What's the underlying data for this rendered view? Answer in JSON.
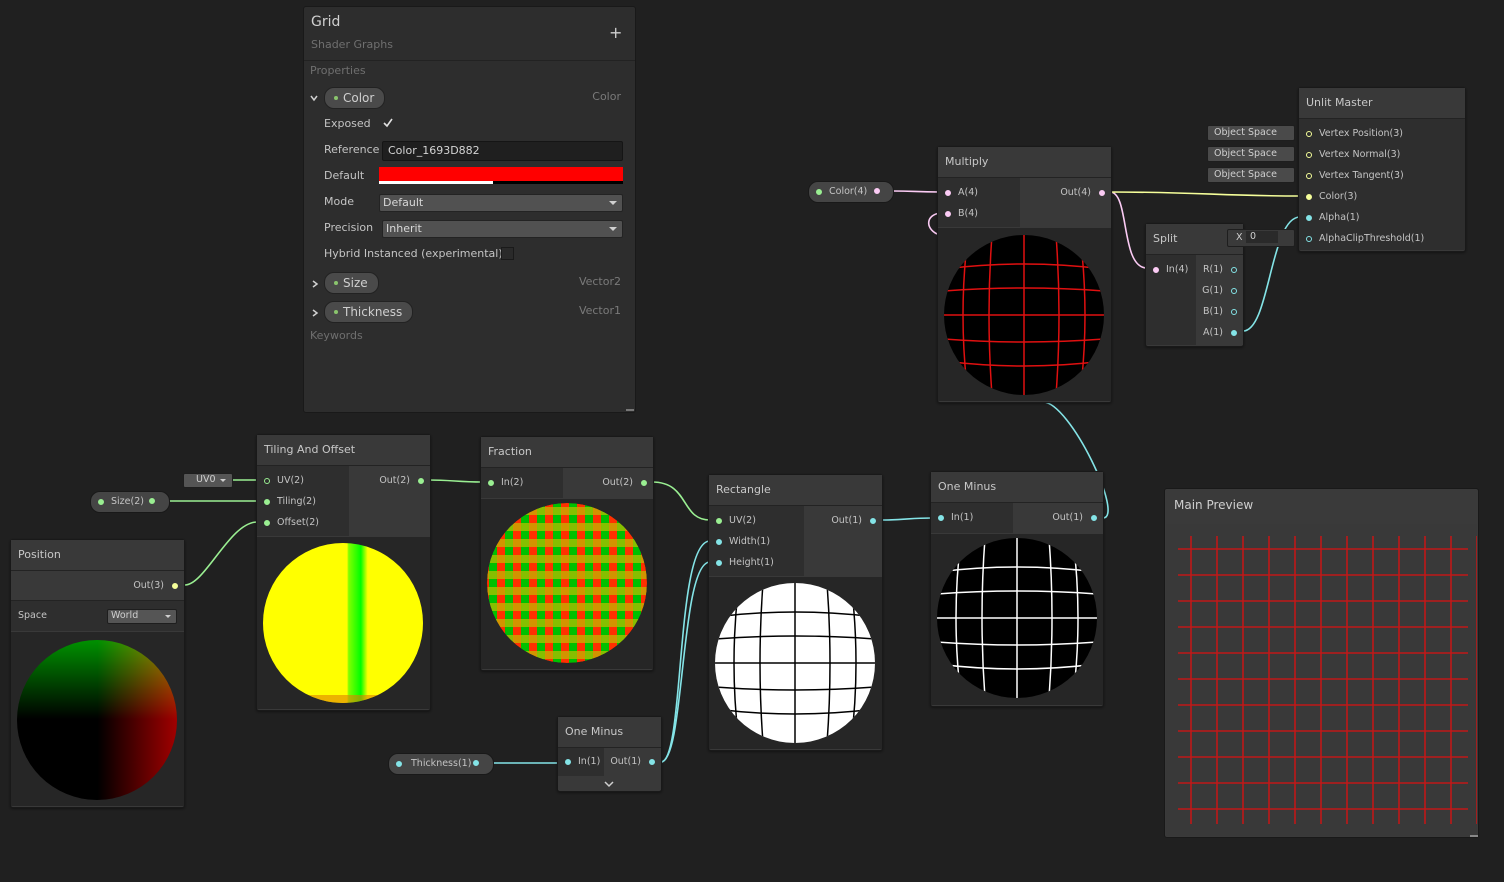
{
  "blackboard": {
    "title": "Grid",
    "subtitle": "Shader Graphs",
    "add_label": "+",
    "properties_label": "Properties",
    "keywords_label": "Keywords",
    "properties": [
      {
        "name": "Color",
        "type": "Color",
        "expanded": true
      },
      {
        "name": "Size",
        "type": "Vector2",
        "expanded": false
      },
      {
        "name": "Thickness",
        "type": "Vector1",
        "expanded": false
      }
    ],
    "color_fields": {
      "exposed_label": "Exposed",
      "exposed_checked": true,
      "reference_label": "Reference",
      "reference_value": "Color_1693D882",
      "default_label": "Default",
      "default_color": "#ff0000",
      "mode_label": "Mode",
      "mode_value": "Default",
      "precision_label": "Precision",
      "precision_value": "Inherit",
      "hybrid_label": "Hybrid Instanced (experimental)",
      "hybrid_checked": false
    }
  },
  "nodes": {
    "position": {
      "title": "Position",
      "out": "Out(3)",
      "space_label": "Space",
      "space_value": "World"
    },
    "tiling": {
      "title": "Tiling And Offset",
      "inputs": [
        "UV(2)",
        "Tiling(2)",
        "Offset(2)"
      ],
      "out": "Out(2)",
      "uv_value": "UV0"
    },
    "fraction": {
      "title": "Fraction",
      "inputs": [
        "In(2)"
      ],
      "out": "Out(2)"
    },
    "rectangle": {
      "title": "Rectangle",
      "inputs": [
        "UV(2)",
        "Width(1)",
        "Height(1)"
      ],
      "out": "Out(1)"
    },
    "one_minus_a": {
      "title": "One Minus",
      "inputs": [
        "In(1)"
      ],
      "out": "Out(1)"
    },
    "one_minus_b": {
      "title": "One Minus",
      "inputs": [
        "In(1)"
      ],
      "out": "Out(1)"
    },
    "multiply": {
      "title": "Multiply",
      "inputs": [
        "A(4)",
        "B(4)"
      ],
      "out": "Out(4)"
    },
    "split": {
      "title": "Split",
      "inputs": [
        "In(4)"
      ],
      "outs": [
        "R(1)",
        "G(1)",
        "B(1)",
        "A(1)"
      ]
    },
    "unlit_master": {
      "title": "Unlit Master",
      "inputs": [
        "Vertex Position(3)",
        "Vertex Normal(3)",
        "Vertex Tangent(3)",
        "Color(3)",
        "Alpha(1)",
        "AlphaClipThreshold(1)"
      ],
      "space_controls": [
        "Object Space",
        "Object Space",
        "Object Space"
      ],
      "alpha_clip_axis": "X",
      "alpha_clip_value": "0"
    }
  },
  "property_nodes": {
    "size": "Size(2)",
    "thickness": "Thickness(1)",
    "color": "Color(4)"
  },
  "main_preview": {
    "title": "Main Preview"
  },
  "colors": {
    "background": "#202020",
    "vector1_port": "#84e4e7",
    "vector2_port": "#9aef92",
    "vector3_port": "#f6ff9a",
    "vector4_port": "#fbcbf4",
    "grid_line": "#c01818"
  }
}
